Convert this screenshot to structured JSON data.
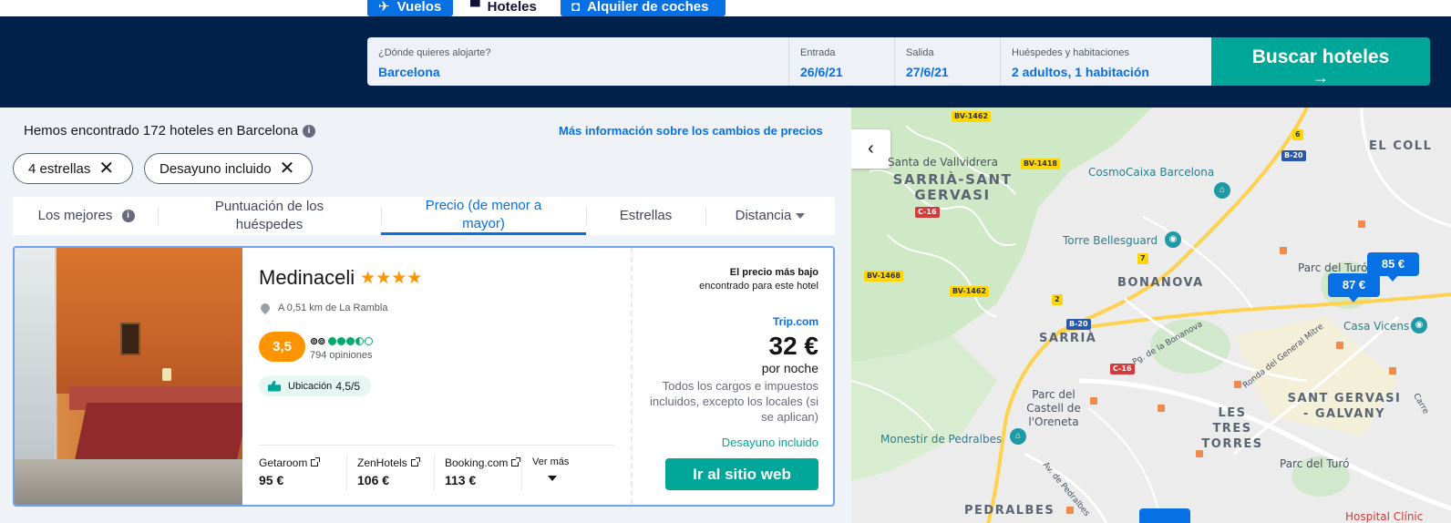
{
  "nav": {
    "tabs": [
      {
        "label": "Vuelos",
        "icon": "plane-icon"
      },
      {
        "label": "Hoteles",
        "icon": "bed-icon"
      },
      {
        "label": "Alquiler de coches",
        "icon": "car-icon"
      }
    ]
  },
  "search": {
    "where_label": "¿Dónde quieres alojarte?",
    "where_value": "Barcelona",
    "checkin_label": "Entrada",
    "checkin_value": "26/6/21",
    "checkout_label": "Salida",
    "checkout_value": "27/6/21",
    "guests_label": "Huéspedes y habitaciones",
    "guests_value": "2 adultos, 1 habitación",
    "button_label": "Buscar hoteles",
    "button_icon": "arrow-right-icon"
  },
  "results": {
    "summary": "Hemos encontrado 172 hoteles en Barcelona",
    "price_changes_link": "Más información sobre los cambios de precios",
    "filters": [
      "4 estrellas",
      "Desayuno incluido"
    ],
    "sort": {
      "best": "Los mejores",
      "guest_rating": "Puntuación de los huéspedes",
      "price": "Precio (de menor a mayor)",
      "stars": "Estrellas",
      "distance": "Distancia",
      "active": "price"
    }
  },
  "hotel": {
    "name": "Medinaceli",
    "stars": 4,
    "distance": "A 0,51 km de La Rambla",
    "score": "3,5",
    "tripadvisor_rating": 3.5,
    "reviews": "794 opiniones",
    "location_label": "Ubicación",
    "location_score": "4,5/5",
    "partners": [
      {
        "name": "Getaroom",
        "price": "95 €"
      },
      {
        "name": "ZenHotels",
        "price": "106 €"
      },
      {
        "name": "Booking.com",
        "price": "113 €"
      }
    ],
    "see_more": "Ver más",
    "lowest_title": "El precio más bajo",
    "lowest_sub": "encontrado para este hotel",
    "provider": "Trip.com",
    "price": "32 €",
    "per_night": "por noche",
    "taxes_note": "Todos los cargos e impuestos incluidos, excepto los locales (si se aplican)",
    "breakfast": "Desayuno incluido",
    "cta": "Ir al sitio web"
  },
  "map": {
    "districts": [
      "SARRIÀ-SANT GERVASI",
      "BONANOVA",
      "SARRIÀ",
      "LES TRES TORRES",
      "SANT GERVASI - GALVANY",
      "PEDRALBES",
      "EL COLL"
    ],
    "pois": [
      "Santa de Vallvidrera",
      "CosmoCaixa Barcelona",
      "Torre Bellesguard",
      "Parc del Turó del",
      "Casa Vicens",
      "Parc del Castell de l'Oreneta",
      "Monestir de Pedralbes",
      "Parc del Turó",
      "Hospital Clínic"
    ],
    "streets": [
      "Pg. de la Bonanova",
      "Ronda del General Mitre",
      "Av. de Pedralbes",
      "Carre"
    ],
    "roads": [
      "BV-1462",
      "BV-1418",
      "C-16",
      "BV-1468",
      "B-20",
      "6",
      "7",
      "2"
    ],
    "price_pins": [
      "85 €",
      "87 €"
    ],
    "colors": {
      "brand": "#0770e3",
      "accent": "#00a698",
      "header": "#02214b",
      "rating": "#ff9400"
    }
  }
}
